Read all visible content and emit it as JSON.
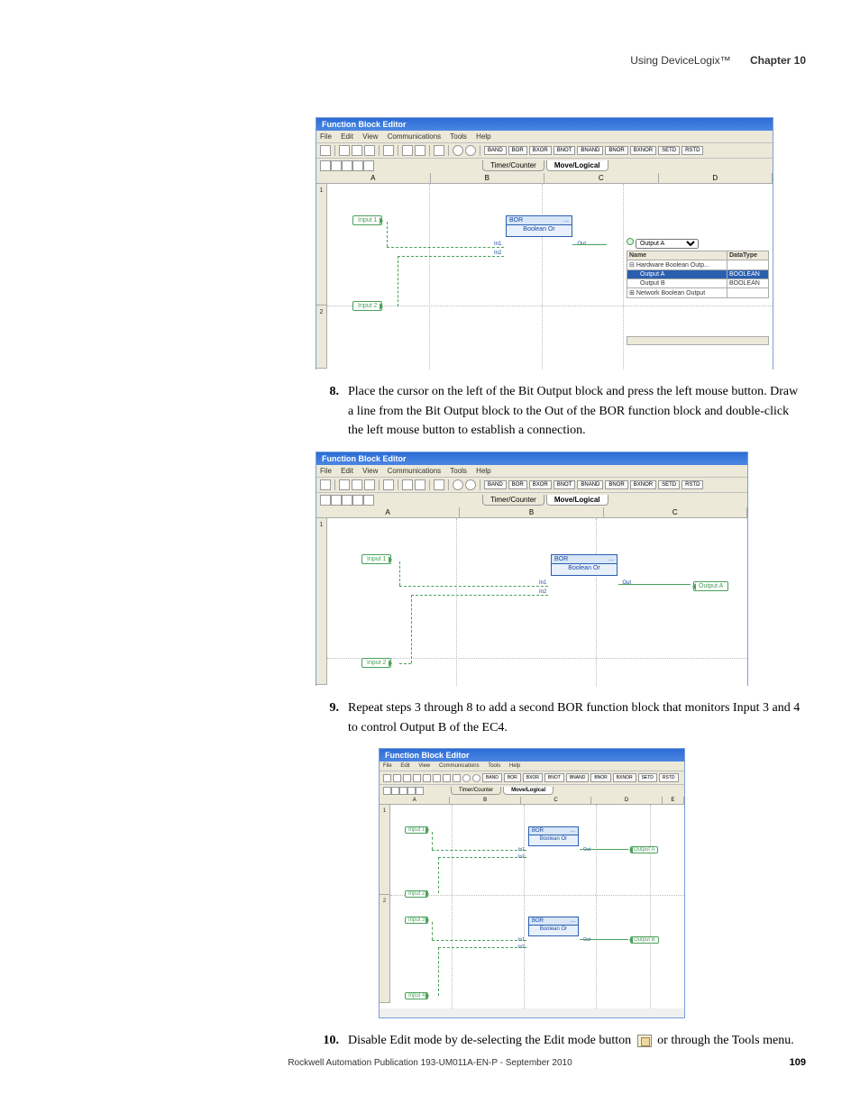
{
  "header": {
    "section": "Using DeviceLogix™",
    "chapter": "Chapter 10"
  },
  "steps": {
    "s8": {
      "num": "8.",
      "text": "Place the cursor on the left of the Bit Output block and press the left mouse button.  Draw a line from the Bit Output block to the Out of the BOR function block and double-click the left mouse button to establish a connection."
    },
    "s9": {
      "num": "9.",
      "text": "Repeat steps 3 through 8 to add a second BOR function block that monitors Input 3 and 4 to control Output B of the EC4."
    },
    "s10": {
      "num": "10.",
      "text_a": "Disable Edit mode by de-selecting the Edit mode button ",
      "text_b": " or through the Tools menu."
    }
  },
  "editor": {
    "title": "Function Block Editor",
    "menu": {
      "file": "File",
      "edit": "Edit",
      "view": "View",
      "comm": "Communications",
      "tools": "Tools",
      "help": "Help"
    },
    "buttons": [
      "BAND",
      "BOR",
      "BXOR",
      "BNOT",
      "BNAND",
      "BNOR",
      "BXNOR",
      "SETD",
      "RSTD"
    ],
    "tabs": {
      "tc": "Timer/Counter",
      "ml": "Move/Logical"
    },
    "cols": {
      "a": "A",
      "b": "B",
      "c": "C",
      "d": "D",
      "e": "E"
    },
    "inputs": {
      "i1": "Input 1",
      "i2": "Input 2",
      "i3": "Input 3",
      "i4": "Input 4"
    },
    "outputs": {
      "oa": "Output A",
      "ob": "Output B"
    },
    "fblock": {
      "name": "BOR",
      "sub": "Boolean Or",
      "in1": "In1",
      "in2": "In2",
      "out": "Out",
      "ellipsis": "..."
    },
    "panel": {
      "sel": "Output A",
      "name": "Name",
      "dt": "DataType",
      "hbo": "Hardware Boolean Outp...",
      "oa": "Output A",
      "ob": "Output B",
      "nbo": "Network Boolean Output",
      "bool": "BOOLEAN"
    }
  },
  "footer": {
    "pub": "Rockwell Automation Publication 193-UM011A-EN-P - September 2010",
    "page": "109"
  }
}
